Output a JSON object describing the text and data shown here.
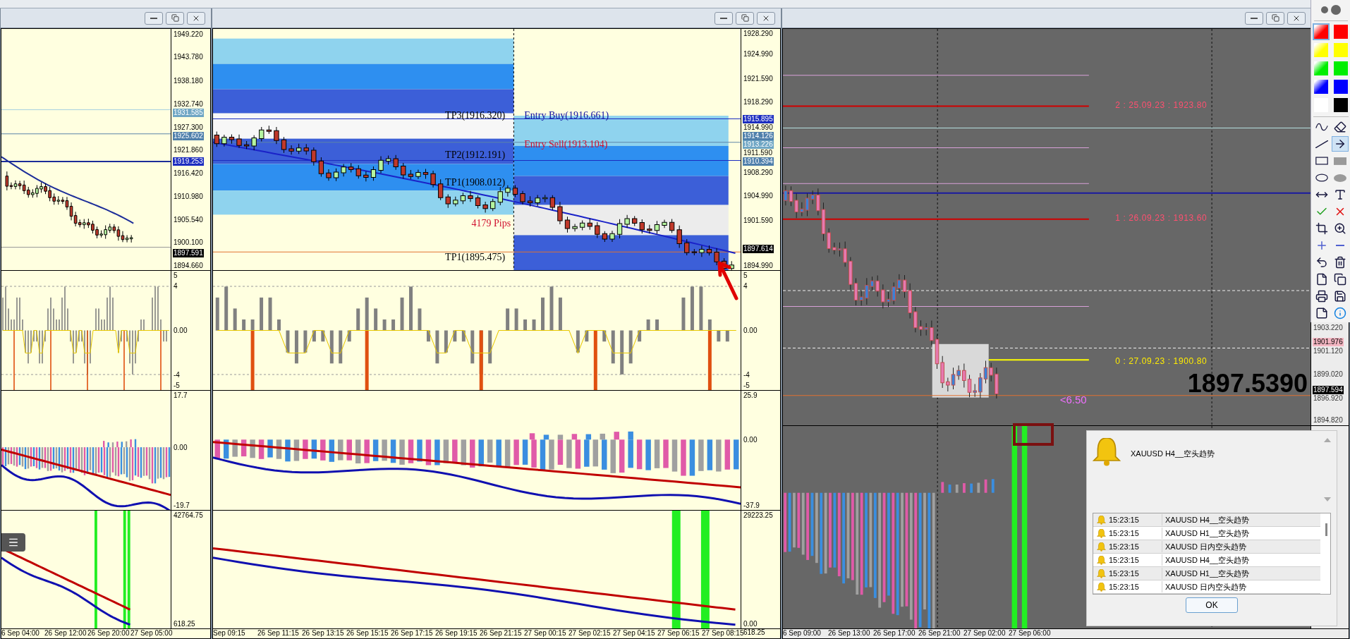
{
  "windows": [
    {
      "panels": [
        {
          "kind": "price",
          "axis": [
            {
              "text": "1949.220",
              "kind": "plain"
            },
            {
              "text": "1943.780",
              "kind": "plain"
            },
            {
              "text": "1938.180",
              "kind": "plain"
            },
            {
              "text": "1932.740",
              "kind": "plain"
            },
            {
              "text": "1931.585",
              "kind": "pale"
            },
            {
              "text": "1927.300",
              "kind": "plain"
            },
            {
              "text": "1925.602",
              "kind": "steel"
            },
            {
              "text": "1921.860",
              "kind": "plain"
            },
            {
              "text": "1919.253",
              "kind": "line"
            },
            {
              "text": "1916.420",
              "kind": "plain"
            },
            {
              "text": "1910.980",
              "kind": "plain"
            },
            {
              "text": "1905.540",
              "kind": "plain"
            },
            {
              "text": "1900.100",
              "kind": "plain"
            },
            {
              "text": "1897.591",
              "kind": "last"
            },
            {
              "text": "1894.660",
              "kind": "plain"
            }
          ]
        },
        {
          "kind": "oscillator",
          "axis": [
            {
              "text": "5",
              "kind": "plain"
            },
            {
              "text": "4",
              "kind": "plain"
            },
            {
              "text": "0.00",
              "kind": "plain"
            },
            {
              "text": "-4",
              "kind": "plain"
            },
            {
              "text": "-5",
              "kind": "plain"
            }
          ]
        },
        {
          "kind": "macd",
          "axis": [
            {
              "text": "17.7",
              "kind": "plain"
            },
            {
              "text": "0.00",
              "kind": "plain"
            },
            {
              "text": "-19.7",
              "kind": "plain"
            }
          ]
        },
        {
          "kind": "signal",
          "axis": [
            {
              "text": "42764.75",
              "kind": "plain"
            },
            {
              "text": "618.25",
              "kind": "plain"
            }
          ]
        }
      ],
      "time_axis": [
        "6 Sep 04:00",
        "26 Sep 12:00",
        "26 Sep 20:00",
        "27 Sep 05:00"
      ]
    },
    {
      "panels": [
        {
          "kind": "price",
          "axis": [
            {
              "text": "1928.290",
              "kind": "plain"
            },
            {
              "text": "1924.990",
              "kind": "plain"
            },
            {
              "text": "1921.590",
              "kind": "plain"
            },
            {
              "text": "1918.290",
              "kind": "plain"
            },
            {
              "text": "1915.895",
              "kind": "line"
            },
            {
              "text": "1914.990",
              "kind": "plain"
            },
            {
              "text": "1914.126",
              "kind": "steel"
            },
            {
              "text": "1913.226",
              "kind": "pale"
            },
            {
              "text": "1911.590",
              "kind": "plain"
            },
            {
              "text": "1910.394",
              "kind": "steel"
            },
            {
              "text": "1908.290",
              "kind": "plain"
            },
            {
              "text": "1904.990",
              "kind": "plain"
            },
            {
              "text": "1901.590",
              "kind": "plain"
            },
            {
              "text": "1897.614",
              "kind": "last"
            },
            {
              "text": "1894.990",
              "kind": "plain"
            }
          ],
          "annotations": [
            {
              "text": "TP3(1916.320)",
              "kind": "target"
            },
            {
              "text": "Entry Buy(1916.661)",
              "kind": "buy"
            },
            {
              "text": "Entry Sell(1913.104)",
              "kind": "sell"
            },
            {
              "text": "TP2(1912.191)",
              "kind": "target"
            },
            {
              "text": "TP1(1908.012)",
              "kind": "target"
            },
            {
              "text": "4179 Pips",
              "kind": "sell"
            },
            {
              "text": "TP1(1895.475)",
              "kind": "target"
            }
          ]
        },
        {
          "kind": "oscillator",
          "axis": [
            {
              "text": "5",
              "kind": "plain"
            },
            {
              "text": "4",
              "kind": "plain"
            },
            {
              "text": "0.00",
              "kind": "plain"
            },
            {
              "text": "-4",
              "kind": "plain"
            },
            {
              "text": "-5",
              "kind": "plain"
            }
          ]
        },
        {
          "kind": "macd",
          "axis": [
            {
              "text": "25.9",
              "kind": "plain"
            },
            {
              "text": "0.00",
              "kind": "plain"
            },
            {
              "text": "-37.9",
              "kind": "plain"
            }
          ]
        },
        {
          "kind": "signal",
          "axis": [
            {
              "text": "29223.25",
              "kind": "plain"
            },
            {
              "text": "0.00",
              "kind": "plain"
            },
            {
              "text": "618.25",
              "kind": "plain"
            }
          ]
        }
      ],
      "time_axis": [
        "Sep 09:15",
        "26 Sep 11:15",
        "26 Sep 13:15",
        "26 Sep 15:15",
        "26 Sep 17:15",
        "26 Sep 19:15",
        "26 Sep 21:15",
        "27 Sep 00:15",
        "27 Sep 02:15",
        "27 Sep 04:15",
        "27 Sep 06:15",
        "27 Sep 08:15"
      ]
    },
    {
      "panels": [
        {
          "kind": "dark-price",
          "axis": [
            {
              "text": "1903.220",
              "kind": "plain"
            },
            {
              "text": "1901.976",
              "kind": "pink"
            },
            {
              "text": "1901.120",
              "kind": "plain"
            },
            {
              "text": "1899.020",
              "kind": "plain"
            },
            {
              "text": "1897.594",
              "kind": "last"
            },
            {
              "text": "1896.920",
              "kind": "plain"
            },
            {
              "text": "1894.820",
              "kind": "plain"
            }
          ],
          "levels": [
            "2 : 25.09.23 : 1923.80",
            "1 : 26.09.23 : 1913.60",
            "0 : 27.09.23 : 1900.80"
          ],
          "readout": "1897.5390",
          "distance": "<6.50"
        },
        {
          "kind": "dark-macd"
        }
      ],
      "time_axis": [
        "6 Sep 09:00",
        "26 Sep 13:00",
        "26 Sep 17:00",
        "26 Sep 21:00",
        "27 Sep 02:00",
        "27 Sep 06:00"
      ]
    }
  ],
  "alert": {
    "message": "XAUUSD  H4__空头趋势",
    "ok": "OK",
    "rows": [
      {
        "time": "15:23:15",
        "message": "XAUUSD  H4__空头趋势"
      },
      {
        "time": "15:23:15",
        "message": "XAUUSD  H1__空头趋势"
      },
      {
        "time": "15:23:15",
        "message": "XAUUSD  日内空头趋势"
      },
      {
        "time": "15:23:15",
        "message": "XAUUSD  H4__空头趋势"
      },
      {
        "time": "15:23:15",
        "message": "XAUUSD  H1__空头趋势"
      },
      {
        "time": "15:23:15",
        "message": "XAUUSD  日内空头趋势"
      }
    ]
  },
  "toolbar": {
    "colors": [
      {
        "color": "#ff0000",
        "kind": "gradient",
        "selected": true
      },
      {
        "color": "#ff0000",
        "kind": "solid",
        "selected": false
      },
      {
        "color": "#ffff00",
        "kind": "gradient",
        "selected": false
      },
      {
        "color": "#ffff00",
        "kind": "solid",
        "selected": false
      },
      {
        "color": "#00ee00",
        "kind": "gradient",
        "selected": false
      },
      {
        "color": "#00ee00",
        "kind": "solid",
        "selected": false
      },
      {
        "color": "#0000ff",
        "kind": "gradient",
        "selected": false
      },
      {
        "color": "#0000ff",
        "kind": "solid",
        "selected": false
      },
      {
        "color": "#ffffff",
        "kind": "solid",
        "selected": false
      },
      {
        "color": "#000000",
        "kind": "solid",
        "selected": false
      }
    ],
    "tools": [
      {
        "kind": "curve",
        "selected": false
      },
      {
        "kind": "eraser",
        "selected": false
      },
      {
        "kind": "line",
        "selected": false
      },
      {
        "kind": "arrow",
        "selected": true
      },
      {
        "kind": "rect",
        "selected": false
      },
      {
        "kind": "filled-rect",
        "selected": false
      },
      {
        "kind": "ellipse",
        "selected": false
      },
      {
        "kind": "filled-ellipse",
        "selected": false
      },
      {
        "kind": "double-arrow",
        "selected": false
      },
      {
        "kind": "text",
        "selected": false
      },
      {
        "kind": "check",
        "selected": false
      },
      {
        "kind": "cross",
        "selected": false
      },
      {
        "kind": "crop",
        "selected": false
      },
      {
        "kind": "zoom",
        "selected": false
      },
      {
        "kind": "plus",
        "selected": false
      },
      {
        "kind": "minus",
        "selected": false
      },
      {
        "kind": "undo",
        "selected": false
      },
      {
        "kind": "trash",
        "selected": false
      },
      {
        "kind": "new",
        "selected": false
      },
      {
        "kind": "copy",
        "selected": false
      },
      {
        "kind": "print",
        "selected": false
      },
      {
        "kind": "save",
        "selected": false
      },
      {
        "kind": "note",
        "selected": false
      },
      {
        "kind": "info",
        "selected": false
      }
    ]
  }
}
